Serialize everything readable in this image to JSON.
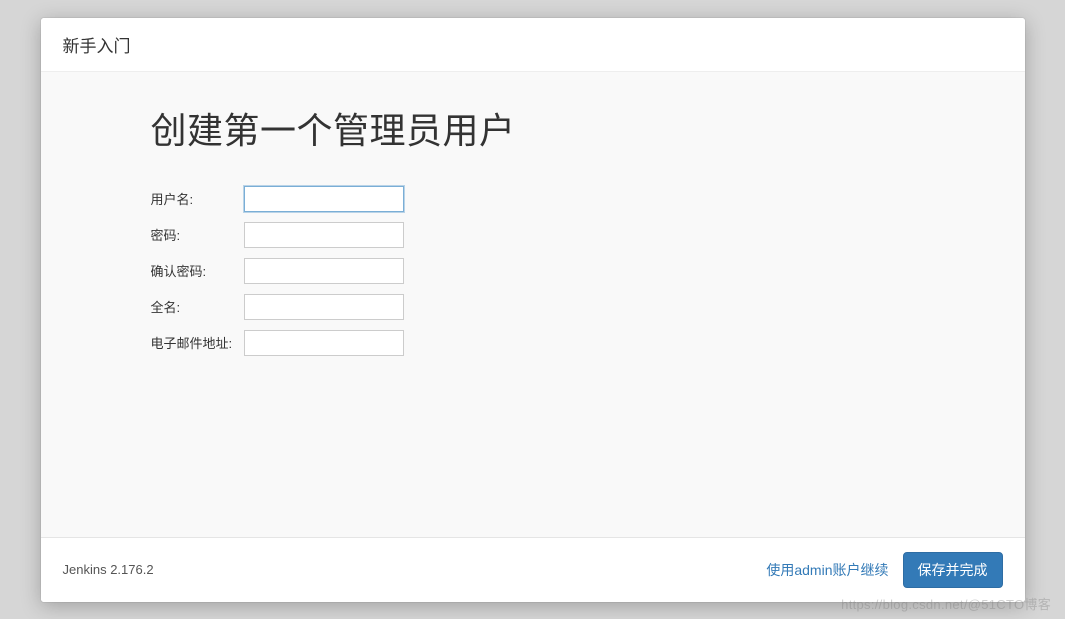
{
  "header": {
    "title": "新手入门"
  },
  "main": {
    "heading": "创建第一个管理员用户",
    "fields": {
      "username": {
        "label": "用户名:",
        "value": ""
      },
      "password": {
        "label": "密码:",
        "value": ""
      },
      "confirm_password": {
        "label": "确认密码:",
        "value": ""
      },
      "fullname": {
        "label": "全名:",
        "value": ""
      },
      "email": {
        "label": "电子邮件地址:",
        "value": ""
      }
    }
  },
  "footer": {
    "version": "Jenkins 2.176.2",
    "skip_label": "使用admin账户继续",
    "save_label": "保存并完成"
  },
  "watermark": "https://blog.csdn.net/@51CTO博客"
}
